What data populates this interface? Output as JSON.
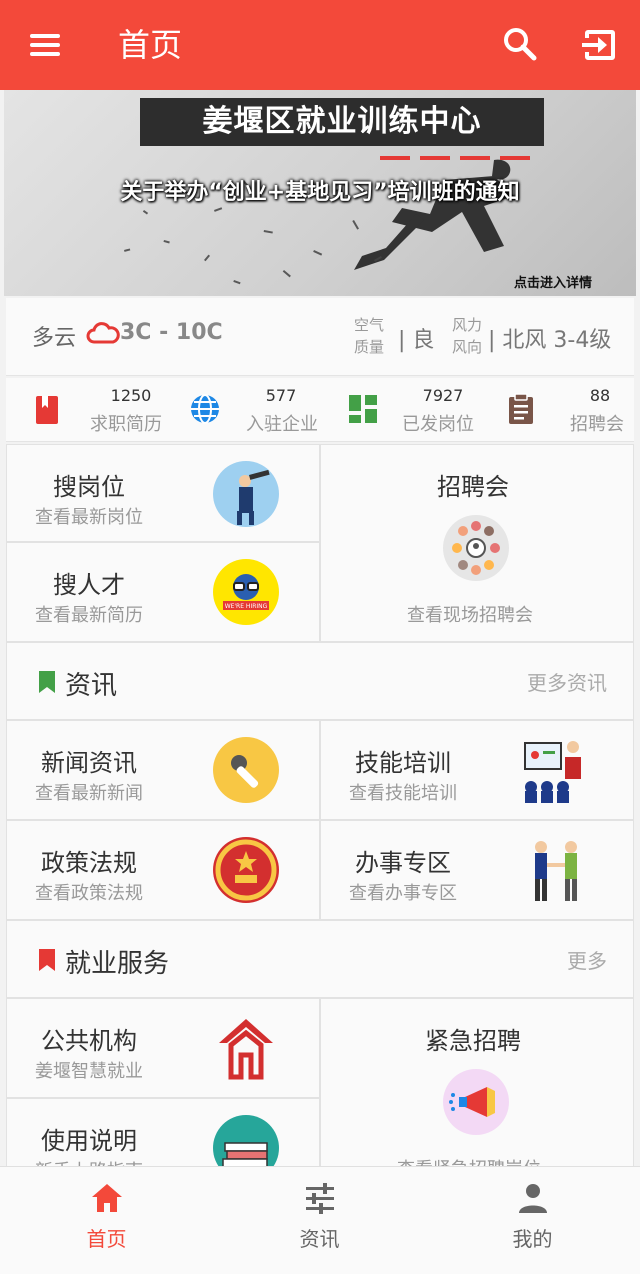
{
  "appbar": {
    "title": "首页"
  },
  "banner": {
    "headline": "姜堰区就业训练中心",
    "subtitle": "关于举办“创业+基地见习”培训班的通知",
    "detail_link": "点击进入详情"
  },
  "weather": {
    "condition": "多云",
    "temperature": "3C - 10C",
    "air_label_1": "空气",
    "air_label_2": "质量",
    "air_value": "| 良",
    "wind_label_1": "风力",
    "wind_label_2": "风向",
    "wind_value": "| 北风 3-4级"
  },
  "stats": [
    {
      "value": "1250",
      "label": "求职简历",
      "icon": "resume-book-icon",
      "color": "#e53935"
    },
    {
      "value": "577",
      "label": "入驻企业",
      "icon": "globe-icon",
      "color": "#1e88e5"
    },
    {
      "value": "7927",
      "label": "已发岗位",
      "icon": "dashboard-grid-icon",
      "color": "#43a047"
    },
    {
      "value": "88",
      "label": "招聘会",
      "icon": "clipboard-icon",
      "color": "#795548"
    }
  ],
  "quick": {
    "search_jobs": {
      "title": "搜岗位",
      "sub": "查看最新岗位"
    },
    "search_talent": {
      "title": "搜人才",
      "sub": "查看最新简历"
    },
    "job_fair": {
      "title": "招聘会",
      "sub": "查看现场招聘会"
    }
  },
  "news_section": {
    "title": "资讯",
    "more": "更多资讯",
    "items": {
      "news": {
        "title": "新闻资讯",
        "sub": "查看最新新闻"
      },
      "training": {
        "title": "技能培训",
        "sub": "查看技能培训"
      },
      "policy": {
        "title": "政策法规",
        "sub": "查看政策法规"
      },
      "affairs": {
        "title": "办事专区",
        "sub": "查看办事专区"
      }
    }
  },
  "service_section": {
    "title": "就业服务",
    "more": "更多",
    "items": {
      "public": {
        "title": "公共机构",
        "sub": "姜堰智慧就业"
      },
      "manual": {
        "title": "使用说明",
        "sub": "新手上路指南"
      },
      "urgent": {
        "title": "紧急招聘",
        "sub": "查看紧急招聘岗位"
      }
    }
  },
  "bottom_nav": [
    {
      "label": "首页",
      "icon": "home-icon",
      "active": true
    },
    {
      "label": "资讯",
      "icon": "sliders-icon",
      "active": false
    },
    {
      "label": "我的",
      "icon": "person-icon",
      "active": false
    }
  ],
  "colors": {
    "primary": "#f3493a",
    "news_flag": "#43a047",
    "service_flag": "#e53935"
  }
}
